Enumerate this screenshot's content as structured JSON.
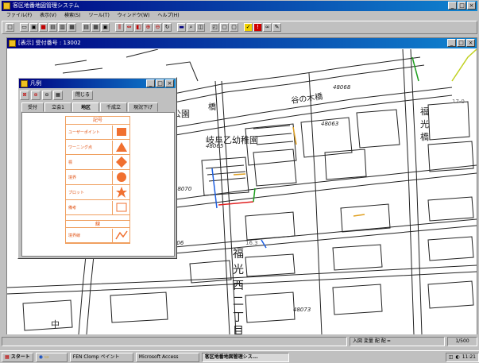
{
  "app": {
    "title": "客区地番地図管理システム"
  },
  "menu": [
    "ファイル(F)",
    "表示(V)",
    "検索(S)",
    "ツール(T)",
    "ウィンドウ(W)",
    "ヘルプ(H)"
  ],
  "toolbar": {
    "icons": [
      "new-icon",
      "open-icon",
      "save-icon",
      "print-icon",
      "cut-icon",
      "copy-icon",
      "paste-icon",
      "layer-icon",
      "grid-icon",
      "window-icon",
      "select-icon",
      "pan-icon",
      "measure-icon",
      "zoom-in-icon",
      "zoom-out-icon",
      "refresh-icon",
      "layer-toggle-icon",
      "search-icon",
      "find-icon",
      "overview-icon",
      "bookmark-icon",
      "note-icon",
      "mark-icon",
      "binoculars-icon",
      "pencil-icon"
    ]
  },
  "map_window": {
    "title": "[表示] 受付番号 : 13002"
  },
  "palette": {
    "title": "凡例",
    "close_label": "閉じる",
    "tabs": [
      "受付",
      "立会1",
      "地区",
      "千成立",
      "現況下げ"
    ],
    "active_tab": 2,
    "legend_header": "記号",
    "items": [
      {
        "label": "ユーザーポイント",
        "shape": "square"
      },
      {
        "label": "ワーニング点",
        "shape": "triangle"
      },
      {
        "label": "標",
        "shape": "diamond"
      },
      {
        "label": "境界",
        "shape": "circle"
      },
      {
        "label": "プロット",
        "shape": "star"
      },
      {
        "label": "備考",
        "shape": "blank"
      }
    ],
    "legend_header2": "線",
    "line_items": [
      {
        "label": "境界線",
        "shape": "polyline"
      }
    ]
  },
  "map": {
    "labels": {
      "kindergarten": "岐阜乙幼稚園",
      "park": "公園",
      "bridge": "谷の木橋",
      "bridge2": "橋",
      "district_col1": "福",
      "district_col2": "光",
      "district_col3": "西",
      "district_col4": "二",
      "district_col5": "丁",
      "district_col6": "目",
      "upper_right_col1": "福",
      "upper_right_col2": "光",
      "upper_right_col3": "橋",
      "naka": "中",
      "area1": "48068",
      "area2": "48063",
      "area3": "48065",
      "area4": "48070",
      "area5": "48006",
      "area6": "48073",
      "small1": "17-0",
      "small2": "16.3"
    }
  },
  "statusbar": {
    "scale": "1/500",
    "nav": "入図 変量 配 配 ━"
  },
  "taskbar": {
    "start": "スタート",
    "tasks": [
      "FEN Clomp ペイント",
      "Microsoft Access",
      "客区地番地図管理シス..."
    ],
    "active_task": 2,
    "clock": "11:21"
  },
  "colors": {
    "titlebar": "#000080",
    "legend_accent": "#e05010",
    "map_line": "#222222"
  }
}
